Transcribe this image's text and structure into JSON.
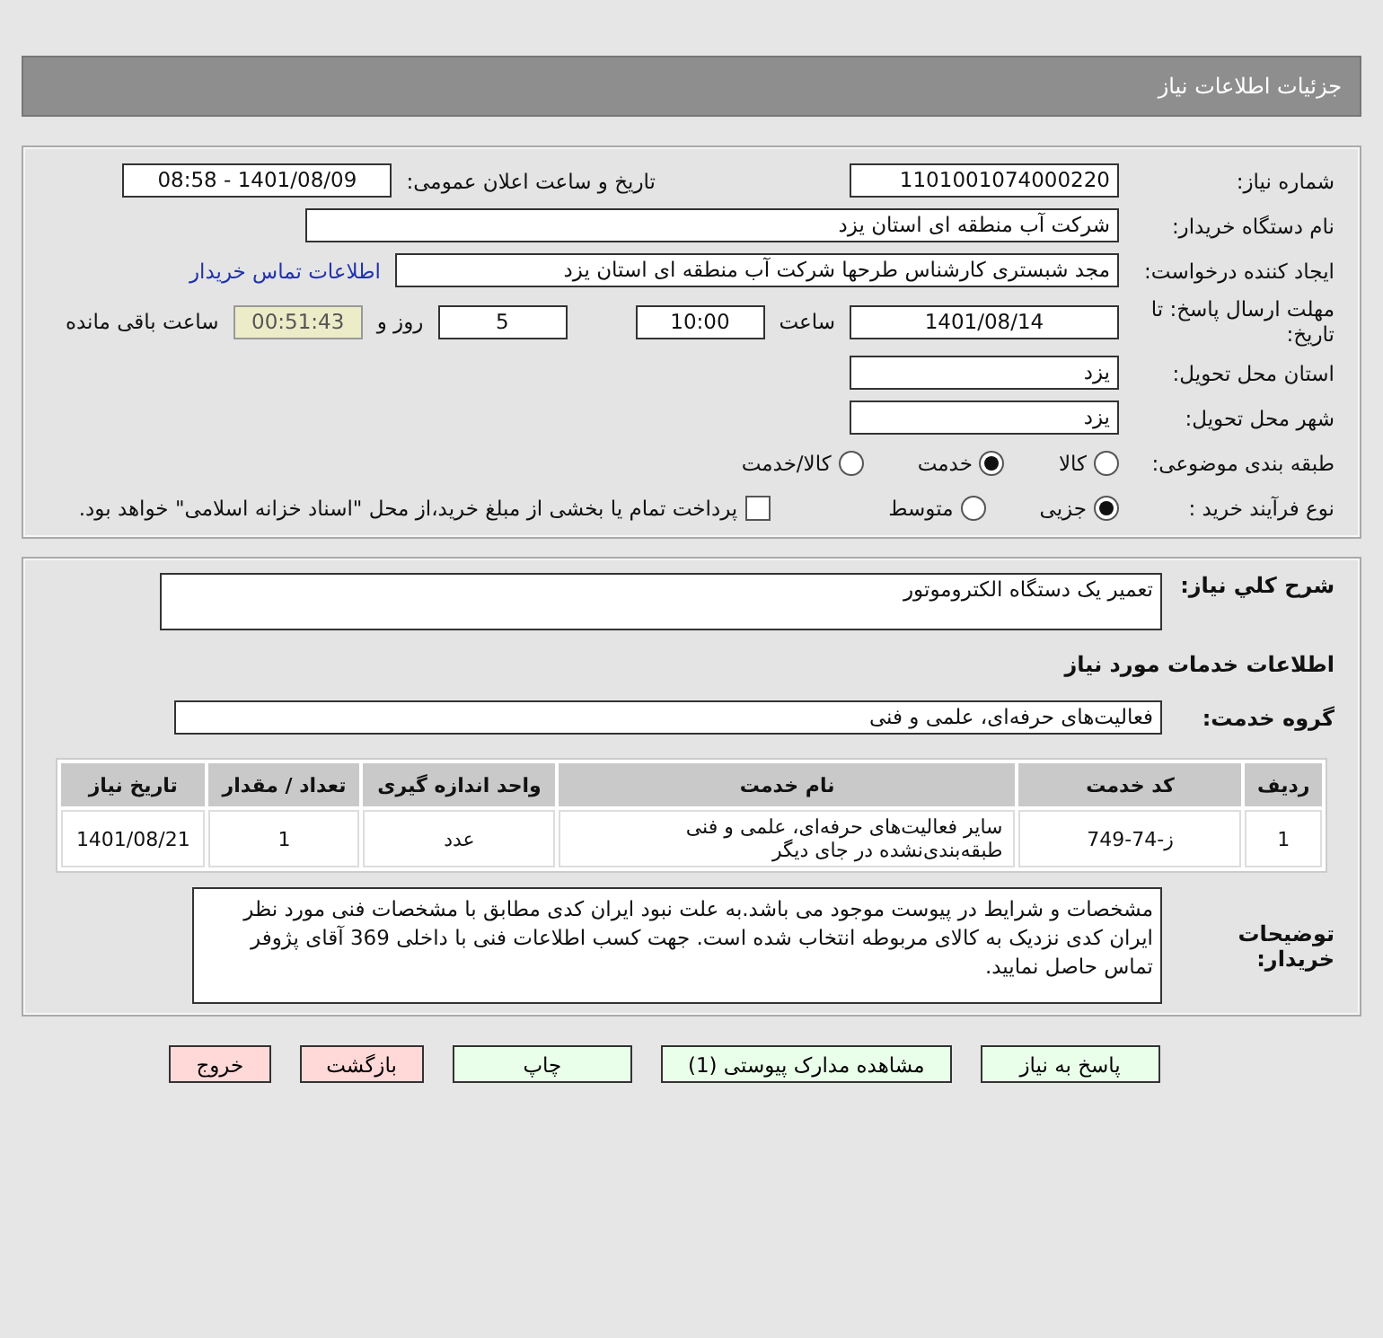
{
  "header": {
    "title": "جزئیات اطلاعات نیاز"
  },
  "details": {
    "need_number": {
      "label": "شماره نیاز:",
      "value": "1101001074000220"
    },
    "announce": {
      "label": "تاریخ و ساعت اعلان عمومی:",
      "value": "1401/08/09 - 08:58"
    },
    "buyer": {
      "label": "نام دستگاه خریدار:",
      "value": "شرکت آب منطقه ای استان یزد"
    },
    "creator": {
      "label": "ایجاد کننده درخواست:",
      "value": "مجد شبستری کارشناس طرحها شرکت آب منطقه ای استان یزد",
      "link": "اطلاعات تماس خریدار"
    },
    "deadline": {
      "label": "مهلت ارسال پاسخ: تا تاریخ:",
      "date": "1401/08/14",
      "time_label": "ساعت",
      "time": "10:00",
      "days": "5",
      "days_label": "روز و",
      "remaining": "00:51:43",
      "remaining_label": "ساعت باقی مانده"
    },
    "province": {
      "label": "استان محل تحویل:",
      "value": "یزد"
    },
    "city": {
      "label": "شهر محل تحویل:",
      "value": "یزد"
    },
    "category": {
      "label": "طبقه بندی موضوعی:",
      "options": [
        {
          "label": "کالا",
          "selected": false
        },
        {
          "label": "خدمت",
          "selected": true
        },
        {
          "label": "کالا/خدمت",
          "selected": false
        }
      ]
    },
    "purchase": {
      "label": "نوع فرآیند خرید :",
      "options": [
        {
          "label": "جزیی",
          "selected": true
        },
        {
          "label": "متوسط",
          "selected": false
        }
      ],
      "treasury": {
        "checked": false,
        "label": "پرداخت تمام یا بخشی از مبلغ خرید،از محل \"اسناد خزانه اسلامی\" خواهد بود."
      }
    }
  },
  "summary": {
    "description": {
      "label": "شرح کلي نياز:",
      "value": "تعمیر یک دستگاه الکتروموتور"
    },
    "services_title": "اطلاعات خدمات مورد نیاز",
    "service_group": {
      "label": "گروه خدمت:",
      "value": "فعالیت‌های حرفه‌ای، علمی و فنی"
    },
    "table": {
      "columns": [
        "ردیف",
        "کد خدمت",
        "نام خدمت",
        "واحد اندازه گیری",
        "تعداد / مقدار",
        "تاریخ نیاز"
      ],
      "rows": [
        [
          "1",
          "ز-74-749",
          "سایر فعالیت‌های حرفه‌ای، علمی و فنی طبقه‌بندی‌نشده در جای دیگر",
          "عدد",
          "1",
          "1401/08/21"
        ]
      ]
    },
    "notes": {
      "label": "توضیحات خریدار:",
      "value": "مشخصات و شرایط در پیوست موجود می باشد.به علت نبود ایران کدی مطابق با مشخصات فنی مورد نظر ایران کدی نزدیک به کالای مربوطه انتخاب شده است. جهت کسب اطلاعات فنی با داخلی 369 آقای پژوفر تماس حاصل نمایید."
    }
  },
  "buttons": [
    {
      "label": "پاسخ به نیاز",
      "kind": "action"
    },
    {
      "label": "مشاهده مدارک پیوستی (1)",
      "kind": "action"
    },
    {
      "label": "چاپ",
      "kind": "action"
    },
    {
      "label": "بازگشت",
      "kind": "exit"
    },
    {
      "label": "خروج",
      "kind": "exit"
    }
  ]
}
